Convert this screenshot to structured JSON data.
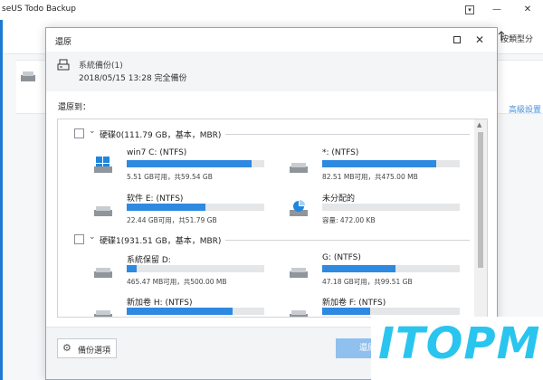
{
  "app": {
    "title": "seUS Todo Backup",
    "window_controls": {
      "menu": "▾",
      "minimize": "—",
      "close": "✕"
    },
    "sort_label": "按類型分",
    "advanced_link": "高級設置"
  },
  "dialog": {
    "title": "還原",
    "maximize_label": "",
    "close_label": "✕",
    "source": {
      "name": "系統備份(1)",
      "meta": "2018/05/15 13:28 完全備份"
    },
    "restore_to_label": "還原到：",
    "disks": [
      {
        "label": "硬碟0(111.79 GB，基本，MBR)",
        "partitions": [
          {
            "name": "win7 C: (NTFS)",
            "info": "5.51 GB可用，共59.54 GB",
            "usage": 0.91,
            "icon": "windows-drive-icon"
          },
          {
            "name": "*: (NTFS)",
            "info": "82.51 MB可用，共475.00 MB",
            "usage": 0.83,
            "icon": "drive-icon"
          },
          {
            "name": "软件 E: (NTFS)",
            "info": "22.44 GB可用，共51.79 GB",
            "usage": 0.57,
            "icon": "drive-icon"
          },
          {
            "name": "未分配的",
            "info": "容量: 472.00 KB",
            "usage": 0.0,
            "icon": "unallocated-drive-icon"
          }
        ]
      },
      {
        "label": "硬碟1(931.51 GB，基本，MBR)",
        "partitions": [
          {
            "name": "系統保留 D:",
            "info": "465.47 MB可用，共500.00 MB",
            "usage": 0.07,
            "icon": "drive-icon"
          },
          {
            "name": "G: (NTFS)",
            "info": "47.18 GB可用，共99.51 GB",
            "usage": 0.53,
            "icon": "drive-icon"
          },
          {
            "name": "新加卷 H: (NTFS)",
            "info": "",
            "usage": 0.77,
            "icon": "drive-icon"
          },
          {
            "name": "新加卷 F: (NTFS)",
            "info": "",
            "usage": 0.35,
            "icon": "drive-icon"
          }
        ]
      }
    ],
    "footer": {
      "options_label": "備份選項",
      "restore_label": "還原"
    }
  },
  "watermark": {
    "text": "ITOPM"
  },
  "colors": {
    "accent": "#2e89e0",
    "bar_track": "#e4e6e8",
    "restore_button": "#8fc0ee",
    "watermark": "#2ac5ee",
    "side_line": "#1d7ad2"
  }
}
